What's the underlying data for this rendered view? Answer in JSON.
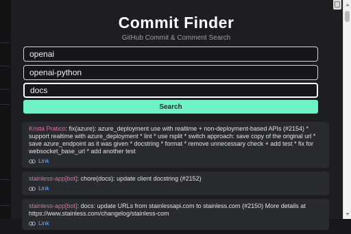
{
  "header": {
    "title": "Commit Finder",
    "subtitle": "GitHub Commit & Comment Search"
  },
  "form": {
    "owner_value": "openai",
    "repo_value": "openai-python",
    "query_value": "docs",
    "search_label": "Search"
  },
  "results": [
    {
      "author": "Krista Pratico",
      "separator": ": ",
      "message": "fix(azure): azure_deployment use with realtime + non-deployment-based APIs (#2154) * support realtime with azure_deployment * lint * use rsplit * switch approach: save copy of the original url * save azure_endpoint as it was given * docstring * format * remove unnecessary check + add test * fix for websocket_base_url * add another test",
      "link_label": "Link"
    },
    {
      "author": "stainless-app[bot]",
      "separator": ": ",
      "message": "chore(docs): update client docstring (#2152)",
      "link_label": "Link"
    },
    {
      "author": "stainless-app[bot]",
      "separator": ": ",
      "message": "docs: update URLs from stainlessapi.com to stainless.com (#2150) More details at https://www.stainless.com/changelog/stainless-com",
      "link_label": "Link"
    }
  ],
  "icons": {
    "link": "link-icon"
  },
  "colors": {
    "accent": "#6ff2c4",
    "author": "#d874a4",
    "link": "#6fb5ff",
    "background": "#1c1e22",
    "card": "#282b30"
  }
}
